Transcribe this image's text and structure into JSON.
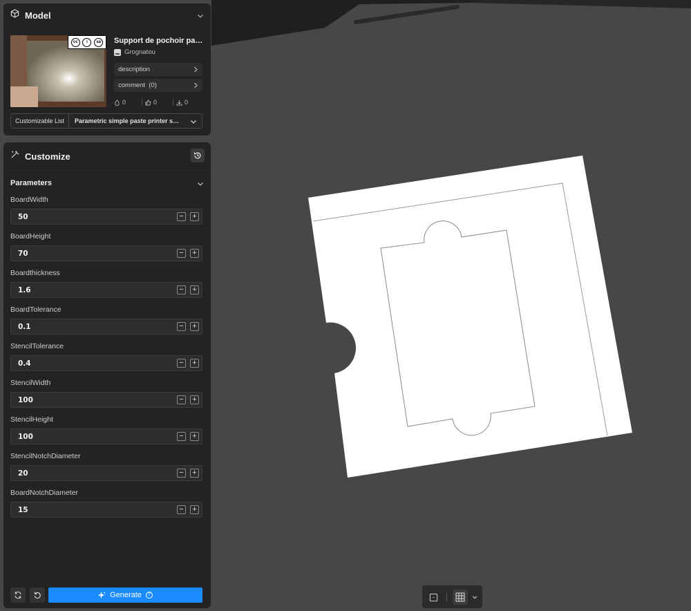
{
  "model_panel": {
    "title": "Model",
    "model_title": "Support de pochoir paramétrique",
    "author": "Grognatou",
    "description_label": "description",
    "comment_label": "comment  (0)",
    "likes": "0",
    "thumbs": "0",
    "downloads": "0",
    "list_label": "Customizable List",
    "list_value": "Parametric simple paste printer stencil holder",
    "license_badge": [
      "cc",
      "i",
      "sa",
      "BY",
      "SA"
    ]
  },
  "customize_panel": {
    "title": "Customize",
    "parameters_label": "Parameters",
    "params": [
      {
        "label": "BoardWidth",
        "value": "50"
      },
      {
        "label": "BoardHeight",
        "value": "70"
      },
      {
        "label": "Boardthickness",
        "value": "1.6"
      },
      {
        "label": "BoardTolerance",
        "value": "0.1"
      },
      {
        "label": "StencilTolerance",
        "value": "0.4"
      },
      {
        "label": "StencilWidth",
        "value": "100"
      },
      {
        "label": "StencilHeight",
        "value": "100"
      },
      {
        "label": "StencilNotchDiameter",
        "value": "20"
      },
      {
        "label": "BoardNotchDiameter",
        "value": "15"
      }
    ],
    "minus": "−",
    "plus": "+",
    "generate_label": "Generate",
    "help_glyph": "?"
  },
  "icons": [
    "cube-icon",
    "chevron-down-icon",
    "chevron-right-icon",
    "magic-wand-icon",
    "history-icon",
    "refresh-icon",
    "undo-icon",
    "sparkle-icon",
    "grid-icon",
    "frame-icon"
  ],
  "colors": {
    "accent": "#1a8cff",
    "panel": "#232323",
    "viewport": "#474747",
    "model": "#ffffff"
  }
}
